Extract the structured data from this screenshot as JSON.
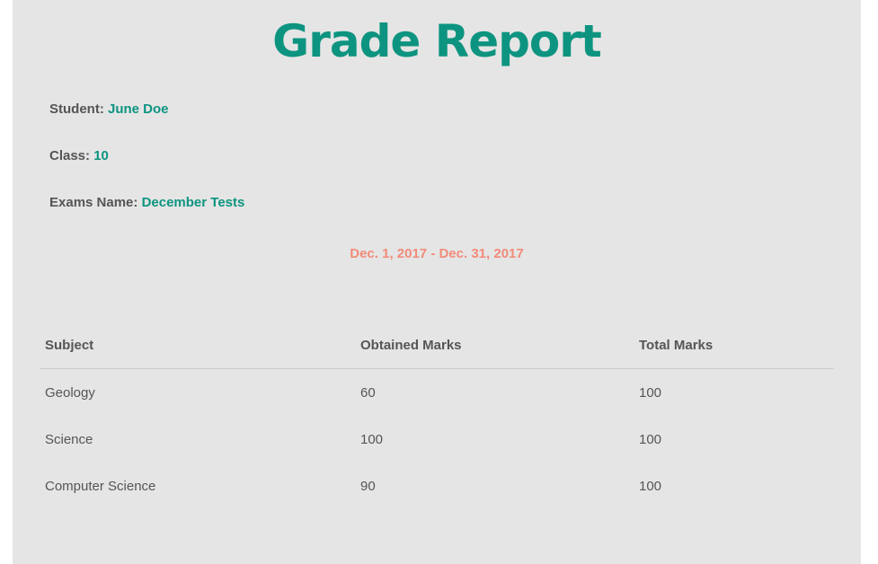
{
  "report": {
    "title": "Grade Report",
    "student_label": "Student:",
    "student_value": "June Doe",
    "class_label": "Class:",
    "class_value": "10",
    "exam_label": "Exams Name:",
    "exam_value": "December Tests",
    "date_range": "Dec. 1, 2017 - Dec. 31, 2017"
  },
  "table": {
    "headers": [
      "Subject",
      "Obtained Marks",
      "Total Marks"
    ],
    "rows": [
      [
        "Geology",
        "60",
        "100"
      ],
      [
        "Science",
        "100",
        "100"
      ],
      [
        "Computer Science",
        "90",
        "100"
      ]
    ]
  },
  "colors": {
    "accent": "#0d9480",
    "date": "#f28b7a",
    "text": "#555555",
    "background": "#e5e5e5"
  }
}
